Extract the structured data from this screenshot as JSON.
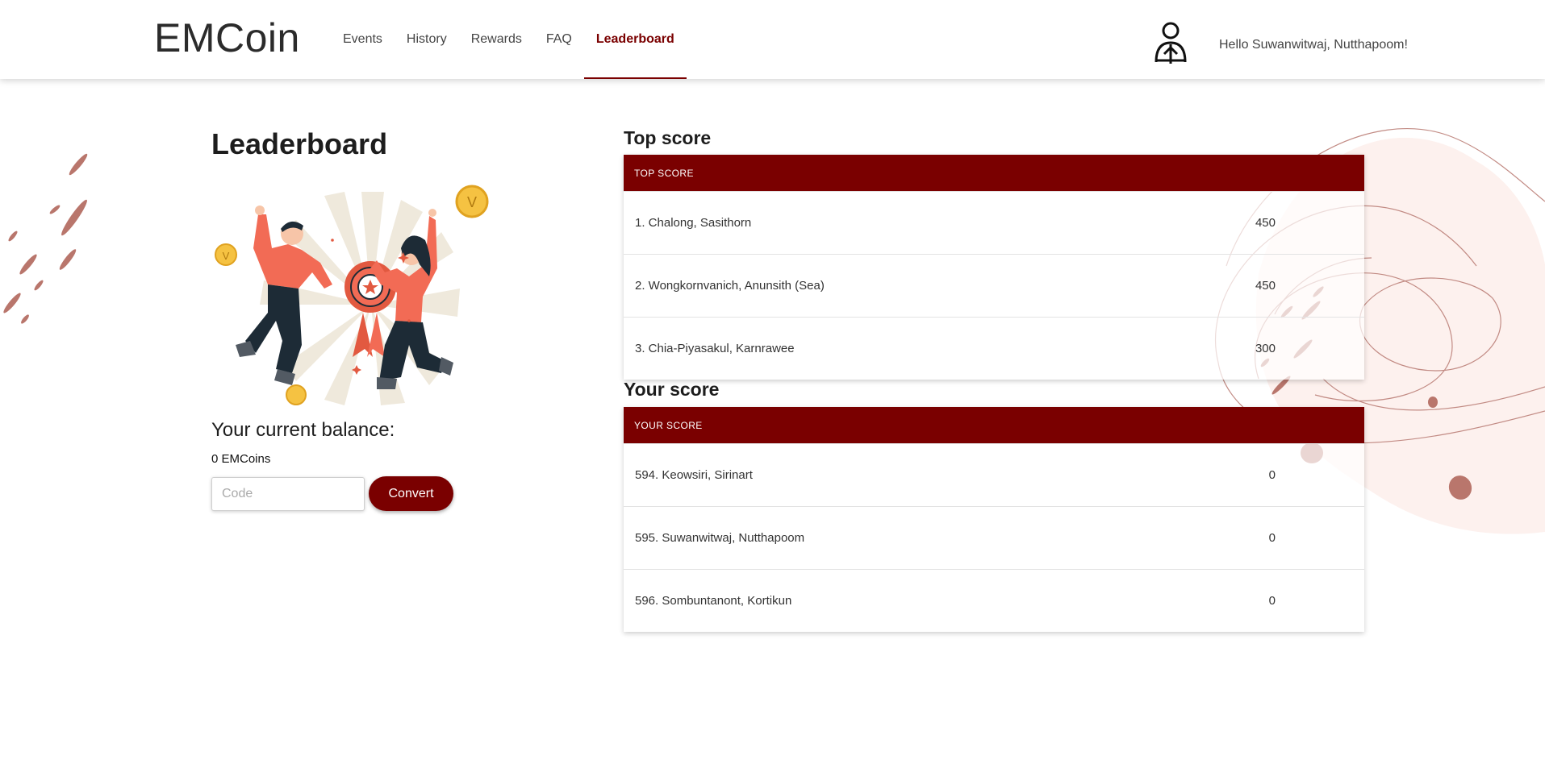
{
  "header": {
    "brand": "EMCoin",
    "nav": [
      {
        "label": "Events"
      },
      {
        "label": "History"
      },
      {
        "label": "Rewards"
      },
      {
        "label": "FAQ"
      },
      {
        "label": "Leaderboard",
        "active": true
      }
    ],
    "greeting": "Hello Suwanwitwaj, Nutthapoom!"
  },
  "main": {
    "title": "Leaderboard",
    "balance_title": "Your current balance:",
    "balance_value": "0 EMCoins",
    "code_placeholder": "Code",
    "convert_label": "Convert"
  },
  "top_score": {
    "title": "Top score",
    "header": "TOP SCORE",
    "rows": [
      {
        "name": "1. Chalong, Sasithorn",
        "score": "450"
      },
      {
        "name": "2. Wongkornvanich, Anunsith (Sea)",
        "score": "450"
      },
      {
        "name": "3. Chia-Piyasakul, Karnrawee",
        "score": "300"
      }
    ]
  },
  "your_score": {
    "title": "Your score",
    "header": "YOUR SCORE",
    "rows": [
      {
        "name": "594. Keowsiri, Sirinart",
        "score": "0"
      },
      {
        "name": "595. Suwanwitwaj, Nutthapoom",
        "score": "0"
      },
      {
        "name": "596. Sombuntanont, Kortikun",
        "score": "0"
      }
    ]
  },
  "colors": {
    "accent": "#7a0000",
    "illustration_salmon": "#f26b55",
    "coin": "#f5c242"
  }
}
